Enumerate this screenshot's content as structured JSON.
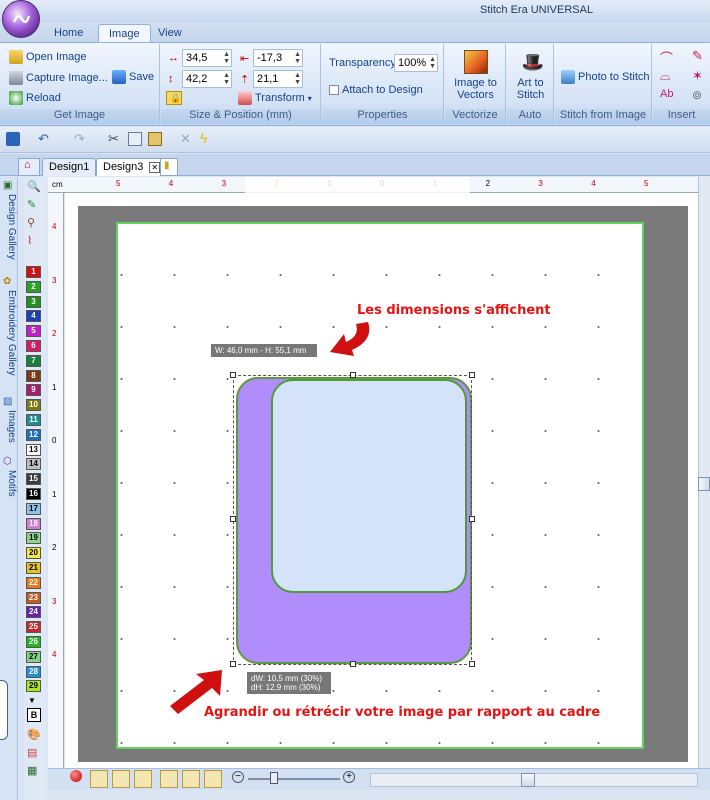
{
  "window": {
    "title": "Stitch Era UNIVERSAL"
  },
  "ribbon_tabs": [
    "Home",
    "Image",
    "View"
  ],
  "get_image": {
    "open_label": "Open Image",
    "capture_label": "Capture Image...",
    "save_label": "Save",
    "reload_label": "Reload",
    "group_label": "Get Image"
  },
  "size_position": {
    "width_value": "34,5",
    "height_value": "42,2",
    "x_value": "-17,3",
    "y_value": "21,1",
    "transform_label": "Transform",
    "group_label": "Size & Position (mm)"
  },
  "properties": {
    "transparency_label": "Transparency",
    "transparency_value": "100%",
    "attach_label": "Attach to Design",
    "group_label": "Properties"
  },
  "vectorize": {
    "button_label_1": "Image to",
    "button_label_2": "Vectors",
    "group_label": "Vectorize"
  },
  "auto": {
    "button_label_1": "Art to",
    "button_label_2": "Stitch",
    "group_label": "Auto"
  },
  "stitch_from_image": {
    "button_label": "Photo to Stitch",
    "group_label": "Stitch from Image"
  },
  "insert": {
    "group_label": "Insert"
  },
  "doc_tabs": [
    "Design1",
    "Design3"
  ],
  "sidebar_tabs": [
    "Design Gallery",
    "Embroidery Gallery",
    "Images",
    "Motifs"
  ],
  "ruler": {
    "unit": "cm",
    "h_labels": [
      "5",
      "4",
      "3",
      "2",
      "1",
      "0",
      "1",
      "2",
      "3",
      "4",
      "5"
    ],
    "v_labels": [
      "4",
      "3",
      "2",
      "1",
      "0",
      "1",
      "2",
      "3",
      "4"
    ]
  },
  "palette": [
    {
      "n": "1",
      "c": "#d01010"
    },
    {
      "n": "2",
      "c": "#2aa22a"
    },
    {
      "n": "3",
      "c": "#1f8f1f"
    },
    {
      "n": "4",
      "c": "#1a3fb8"
    },
    {
      "n": "5",
      "c": "#c21ec7"
    },
    {
      "n": "6",
      "c": "#d81b60"
    },
    {
      "n": "7",
      "c": "#1a7f3a"
    },
    {
      "n": "8",
      "c": "#7a3a1a"
    },
    {
      "n": "9",
      "c": "#a81e6a"
    },
    {
      "n": "10",
      "c": "#7a7a10"
    },
    {
      "n": "11",
      "c": "#1f8f8f"
    },
    {
      "n": "12",
      "c": "#1e6fb8"
    },
    {
      "n": "13",
      "c": "#ffffff"
    },
    {
      "n": "14",
      "c": "#bfbfbf"
    },
    {
      "n": "15",
      "c": "#3d3d3d"
    },
    {
      "n": "16",
      "c": "#000000"
    },
    {
      "n": "17",
      "c": "#8ec1e6"
    },
    {
      "n": "18",
      "c": "#d47ad4"
    },
    {
      "n": "19",
      "c": "#8fd48f"
    },
    {
      "n": "20",
      "c": "#f2e84a"
    },
    {
      "n": "21",
      "c": "#e8c21e"
    },
    {
      "n": "22",
      "c": "#e87a1e"
    },
    {
      "n": "23",
      "c": "#c75a1e"
    },
    {
      "n": "24",
      "c": "#6a1eb8"
    },
    {
      "n": "25",
      "c": "#c72a2a"
    },
    {
      "n": "26",
      "c": "#1eb81e"
    },
    {
      "n": "27",
      "c": "#7fd47f"
    },
    {
      "n": "28",
      "c": "#1e8fd4"
    },
    {
      "n": "29",
      "c": "#a8e81e"
    }
  ],
  "tooltips": {
    "dimensions": "W: 46,0 mm - H: 55,1 mm",
    "delta_w": "dW: 10,5 mm (30%)",
    "delta_h": "dH: 12,9 mm (30%)"
  },
  "annotations": {
    "top": "Les dimensions s'affichent",
    "bottom": "Agrandir ou rétrécir votre image par rapport au cadre"
  },
  "colors": {
    "annotation": "#e51313",
    "shape_fill": "#b08dfa",
    "inner_fill": "#d4e3fa",
    "outline": "#5b9a3b",
    "hoop": "#5fd25f"
  }
}
